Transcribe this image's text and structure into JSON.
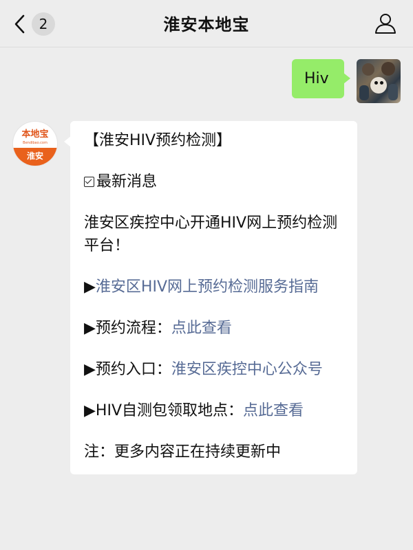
{
  "header": {
    "unread_count": "2",
    "title": "淮安本地宝"
  },
  "outgoing": {
    "text": "Hiv"
  },
  "brand_avatar": {
    "top_text": "本地宝",
    "sub_text": "Bendibao.com",
    "bottom_text": "淮安"
  },
  "incoming": {
    "title": "【淮安HIV预约检测】",
    "section": "最新消息",
    "intro": "淮安区疾控中心开通HIV网上预约检测平台！",
    "guide_arrow": "▶",
    "guide_link": "淮安区HIV网上预约检测服务指南",
    "process_label": "▶预约流程：",
    "process_link": "点此查看",
    "entry_label": "▶预约入口：",
    "entry_link": "淮安区疾控中心公众号",
    "kit_label": "▶HIV自测包领取地点：",
    "kit_link": "点此查看",
    "note": "注：更多内容正在持续更新中"
  }
}
